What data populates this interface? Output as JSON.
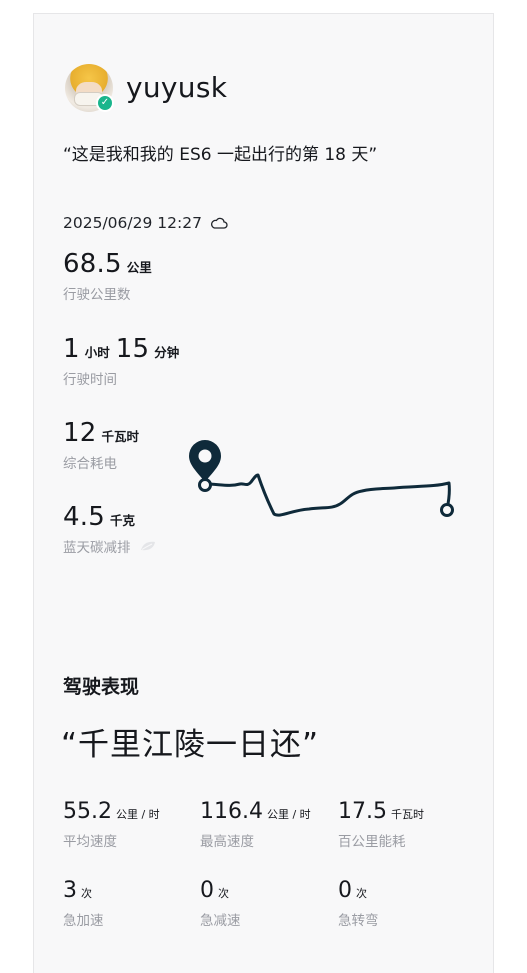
{
  "profile": {
    "username": "yuyusk",
    "quote": "“这是我和我的 ES6 一起出行的第 18 天”"
  },
  "trip": {
    "datetime": "2025/06/29 12:27",
    "weather_icon": "cloud-icon",
    "distance": {
      "value": "68.5",
      "unit": "公里",
      "label": "行驶公里数"
    },
    "duration": {
      "hours": "1",
      "hours_unit": "小时",
      "minutes": "15",
      "minutes_unit": "分钟",
      "label": "行驶时间"
    },
    "energy": {
      "value": "12",
      "unit": "千瓦时",
      "label": "综合耗电"
    },
    "carbon": {
      "value": "4.5",
      "unit": "千克",
      "label": "蓝天碳减排",
      "icon": "leaf-icon"
    }
  },
  "driving": {
    "section_title": "驾驶表现",
    "slogan": "“千里江陵一日还”",
    "metrics": [
      {
        "value": "55.2",
        "unit": "公里 / 时",
        "label": "平均速度"
      },
      {
        "value": "116.4",
        "unit": "公里 / 时",
        "label": "最高速度"
      },
      {
        "value": "17.5",
        "unit": "千瓦时",
        "label": "百公里能耗"
      },
      {
        "value": "3",
        "unit": "次",
        "label": "急加速"
      },
      {
        "value": "0",
        "unit": "次",
        "label": "急减速"
      },
      {
        "value": "0",
        "unit": "次",
        "label": "急转弯"
      }
    ]
  },
  "colors": {
    "text": "#16181d",
    "muted": "#9a9ca3",
    "route": "#0f2a3a",
    "verified": "#19b58c"
  }
}
